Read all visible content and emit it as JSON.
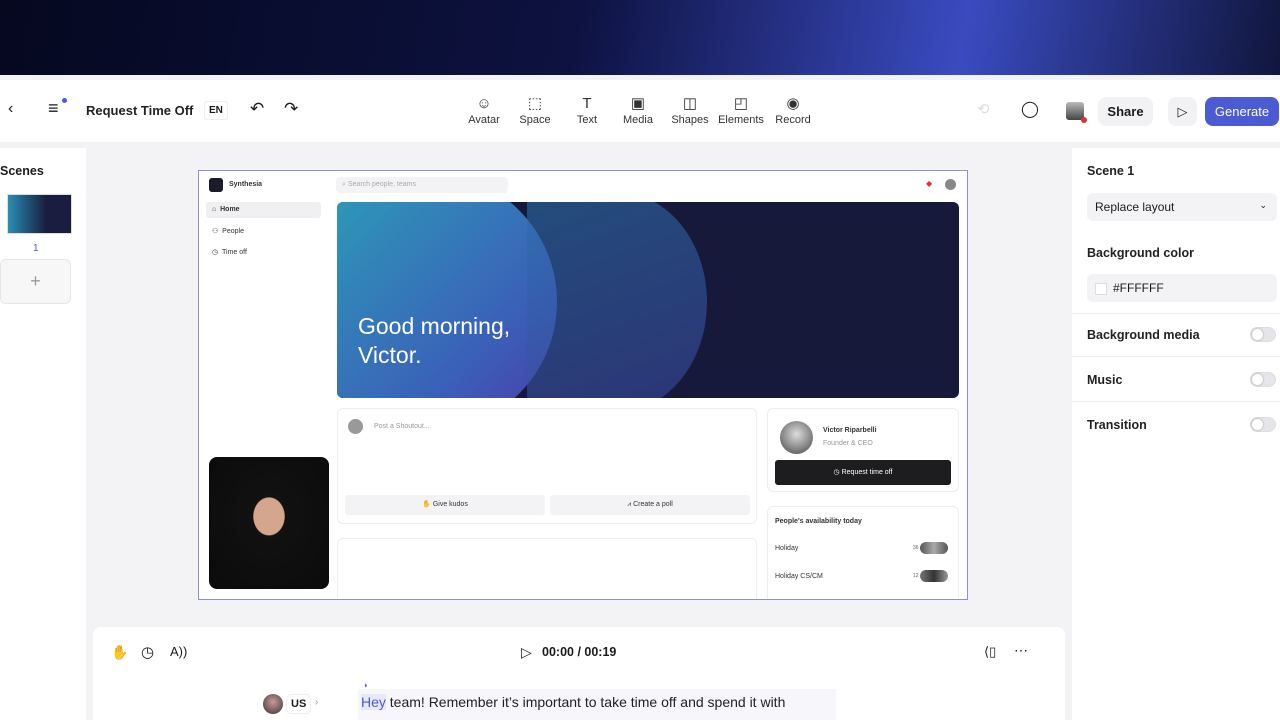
{
  "toolbar": {
    "title": "Request Time Off",
    "lang": "EN",
    "tools": [
      {
        "label": "Avatar",
        "icon": "☺"
      },
      {
        "label": "Space",
        "icon": "⬚"
      },
      {
        "label": "Text",
        "icon": "T"
      },
      {
        "label": "Media",
        "icon": "▣"
      },
      {
        "label": "Shapes",
        "icon": "◫"
      },
      {
        "label": "Elements",
        "icon": "◰"
      },
      {
        "label": "Record",
        "icon": "◉"
      }
    ],
    "share": "Share",
    "generate": "Generate",
    "accent": "#4a5bd4"
  },
  "scenes": {
    "title": "Scenes",
    "items": [
      {
        "number": "1"
      }
    ],
    "add": "+"
  },
  "slide": {
    "brand": "Synthesia",
    "search_placeholder": "Search people, teams",
    "nav": [
      "Home",
      "People",
      "Time off"
    ],
    "greeting_line1": "Good morning,",
    "greeting_line2": "Victor.",
    "post_placeholder": "Post a Shoutout...",
    "kudos": "Give kudos",
    "poll": "Create a poll",
    "profile_name": "Victor Riparbelli",
    "profile_role": "Founder & CEO",
    "request_button": "Request time off",
    "availability_title": "People's availability today",
    "availability": [
      {
        "label": "Holiday",
        "count": "36"
      },
      {
        "label": "Holiday CS/CM",
        "count": "12"
      }
    ]
  },
  "right_panel": {
    "scene": "Scene 1",
    "layout": "Replace layout",
    "bg_color_label": "Background color",
    "bg_color": "#FFFFFF",
    "bg_media": "Background media",
    "music": "Music",
    "transition": "Transition"
  },
  "script": {
    "time": "00:00 / 00:19",
    "lang": "US",
    "highlight": "Hey",
    "text": " team! Remember it’s important to take time off and spend it with"
  }
}
